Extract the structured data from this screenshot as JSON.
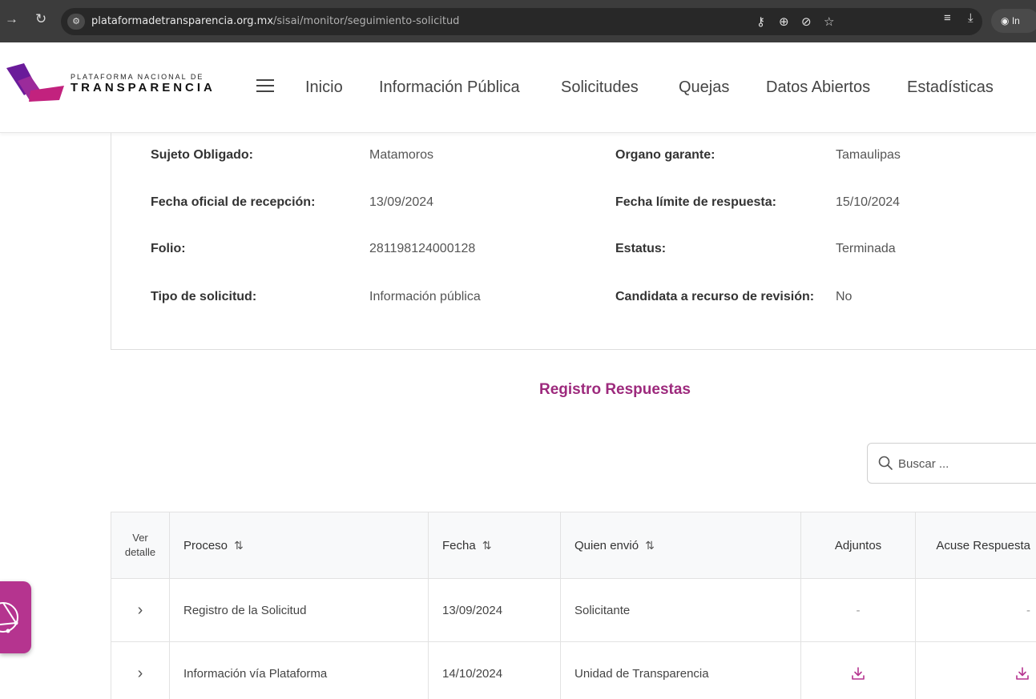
{
  "browser": {
    "url_host": "plataformadetransparencia.org.mx",
    "url_path": "/sisai/monitor/seguimiento-solicitud",
    "incognito_label": "In"
  },
  "header": {
    "logo_top": "PLATAFORMA NACIONAL DE",
    "logo_bottom": "TRANSPARENCIA",
    "nav": [
      "Inicio",
      "Información Pública",
      "Solicitudes",
      "Quejas",
      "Datos Abiertos",
      "Estadísticas"
    ]
  },
  "details": {
    "sujeto_label": "Sujeto Obligado:",
    "sujeto_value": "Matamoros",
    "organo_label": "Organo garante:",
    "organo_value": "Tamaulipas",
    "recepcion_label": "Fecha oficial de recepción:",
    "recepcion_value": "13/09/2024",
    "limite_label": "Fecha límite de respuesta:",
    "limite_value": "15/10/2024",
    "folio_label": "Folio:",
    "folio_value": "281198124000128",
    "estatus_label": "Estatus:",
    "estatus_value": "Terminada",
    "tipo_label": "Tipo de solicitud:",
    "tipo_value": "Información pública",
    "candidata_label": "Candidata a recurso de revisión:",
    "candidata_value": "No"
  },
  "section": {
    "title": "Registro Respuestas"
  },
  "search": {
    "placeholder": "Buscar ..."
  },
  "table": {
    "headers": {
      "ver_line1": "Ver",
      "ver_line2": "detalle",
      "proceso": "Proceso",
      "fecha": "Fecha",
      "quien": "Quien envió",
      "adjuntos": "Adjuntos",
      "acuse": "Acuse Respuesta"
    },
    "sort_glyph": "⇅",
    "rows": [
      {
        "proceso": "Registro de la Solicitud",
        "fecha": "13/09/2024",
        "quien": "Solicitante",
        "adjuntos": "-",
        "acuse": "-"
      },
      {
        "proceso": "Información vía Plataforma",
        "fecha": "14/10/2024",
        "quien": "Unidad de Transparencia",
        "adjuntos": "download-icon",
        "acuse": "download-icon"
      }
    ]
  },
  "colors": {
    "accent": "#9d2a7d",
    "fab": "#b5348f"
  }
}
